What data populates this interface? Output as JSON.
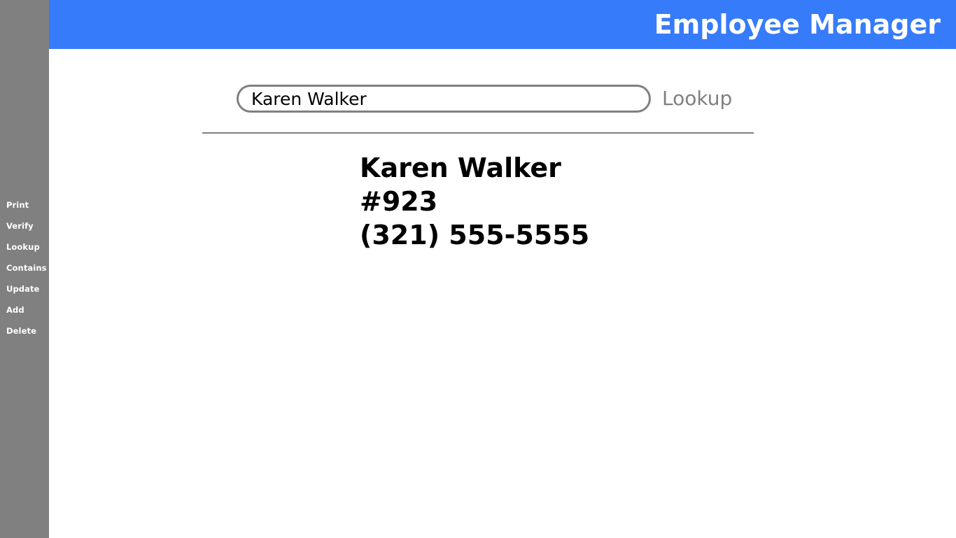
{
  "header": {
    "title": "Employee Manager"
  },
  "sidebar": {
    "items": [
      {
        "label": "Print"
      },
      {
        "label": "Verify"
      },
      {
        "label": "Lookup"
      },
      {
        "label": "Contains"
      },
      {
        "label": "Update"
      },
      {
        "label": "Add"
      },
      {
        "label": "Delete"
      }
    ]
  },
  "search": {
    "value": "Karen Walker",
    "button_label": "Lookup"
  },
  "result": {
    "name": "Karen Walker",
    "id": "#923",
    "phone": "(321) 555-5555"
  },
  "colors": {
    "header": "#367bfa",
    "sidebar": "#808080",
    "border": "#808080"
  }
}
